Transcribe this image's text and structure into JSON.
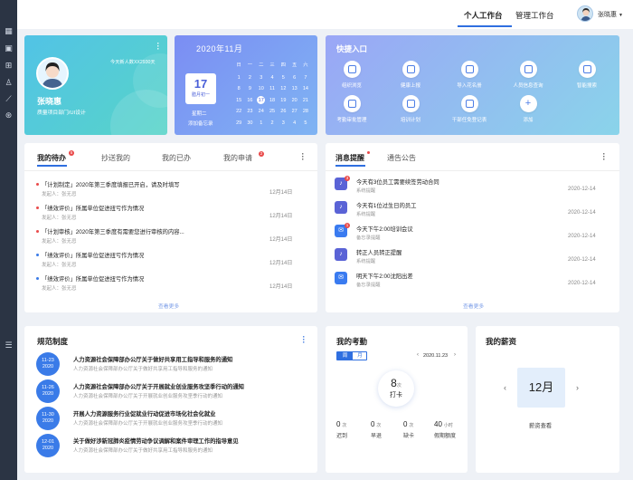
{
  "topbar": {
    "tabs": [
      {
        "label": "个人工作台"
      },
      {
        "label": "管理工作台"
      }
    ],
    "user_name": "张晓惠"
  },
  "profile": {
    "new_today": "今天新人数XX2930天",
    "name": "张晓惠",
    "dept": "质量项目部门/UI设计"
  },
  "calendar": {
    "month_title": "2020年11月",
    "day": "17",
    "lunar": "腊月初一",
    "weekday": "星期二",
    "add_memo": "添加备忘录",
    "week_head": [
      "日",
      "一",
      "二",
      "三",
      "四",
      "五",
      "六"
    ],
    "rows": [
      [
        "1",
        "2",
        "3",
        "4",
        "5",
        "6",
        "7"
      ],
      [
        "8",
        "9",
        "10",
        "11",
        "12",
        "13",
        "14"
      ],
      [
        "15",
        "16",
        "17",
        "18",
        "19",
        "20",
        "21"
      ],
      [
        "22",
        "23",
        "24",
        "25",
        "26",
        "27",
        "28"
      ],
      [
        "29",
        "30",
        "1",
        "2",
        "3",
        "4",
        "5"
      ]
    ],
    "today_index": "17"
  },
  "quick": {
    "title": "快捷入口",
    "items": [
      {
        "label": "组织浏览"
      },
      {
        "label": "健康上报"
      },
      {
        "label": "导入花名册"
      },
      {
        "label": "人员信息查询"
      },
      {
        "label": "智能搜索"
      },
      {
        "label": "考勤审批管理"
      },
      {
        "label": "培训计划"
      },
      {
        "label": "干部任免登记表"
      },
      {
        "label": "添加"
      }
    ]
  },
  "todo": {
    "tabs": [
      {
        "label": "我的待办",
        "badge": "5"
      },
      {
        "label": "抄送我的"
      },
      {
        "label": "我的已办"
      },
      {
        "label": "我的申请",
        "badge": "2"
      }
    ],
    "rows": [
      {
        "title": "「计划制定」2020年第三季度填报已开启，请及时填写",
        "sub": "发起人：张无忌",
        "date": "12月14日"
      },
      {
        "title": "「绩效评价」所属单位促进扭亏作为情况",
        "sub": "发起人：张无忌",
        "date": "12月14日"
      },
      {
        "title": "「计划审核」2020年第三季度有需要您进行审核的内容...",
        "sub": "发起人：张无忌",
        "date": "12月14日"
      },
      {
        "title": "「绩效评价」所属单位促进扭亏作为情况",
        "sub": "发起人：张无忌",
        "date": "12月14日"
      },
      {
        "title": "「绩效评价」所属单位促进扭亏作为情况",
        "sub": "发起人：张无忌",
        "date": "12月14日"
      }
    ],
    "more": "查看更多"
  },
  "notice": {
    "tabs": [
      {
        "label": "消息提醒"
      },
      {
        "label": "通告公告"
      }
    ],
    "rows": [
      {
        "title": "今天有3位员工需要续签劳动合同",
        "sub": "系统提醒",
        "date": "2020-12-14",
        "badge": "3"
      },
      {
        "title": "今天有1位过生日的员工",
        "sub": "系统提醒",
        "date": "2020-12-14"
      },
      {
        "title": "今天下午2:00培训会议",
        "sub": "备忘录提醒",
        "date": "2020-12-14",
        "badge": "1"
      },
      {
        "title": "转正人员转正提醒",
        "sub": "系统提醒",
        "date": "2020-12-14"
      },
      {
        "title": "明天下午2:00沈阳出差",
        "sub": "备忘录提醒",
        "date": "2020-12-14"
      }
    ],
    "more": "查看更多"
  },
  "rules": {
    "title": "规范制度",
    "rows": [
      {
        "date_mm": "11-23",
        "date_yy": "2020",
        "title": "人力资源社会保障部办公厅关于做好共享用工指导和服务的通知",
        "sub": "人力资源社会保障部办公厅关于做好共享用工指导和服务的通知"
      },
      {
        "date_mm": "11-26",
        "date_yy": "2020",
        "title": "人力资源社会保障部办公厅关于开展就业创业服务攻坚季行动的通知",
        "sub": "人力资源社会保障部办公厅关于开展就业创业服务攻坚季行动的通知"
      },
      {
        "date_mm": "11-30",
        "date_yy": "2020",
        "title": "开展人力资源服务行业促就业行动促进市场化社会化就业",
        "sub": "人力资源社会保障部办公厅关于开展就业创业服务攻坚季行动的通知"
      },
      {
        "date_mm": "12-01",
        "date_yy": "2020",
        "title": "关于做好涉新冠肺炎疫情劳动争议调解和案件审理工作的指导意见",
        "sub": "人力资源社会保障部办公厅关于做好共享用工指导和服务的通知"
      }
    ]
  },
  "attendance": {
    "title": "我的考勤",
    "toggle": [
      "周",
      "月"
    ],
    "date": "2020.11.23",
    "count": "8",
    "count_unit": "次",
    "punch": "打卡",
    "stats": [
      {
        "n": "0",
        "u": "次",
        "label": "迟到"
      },
      {
        "n": "0",
        "u": "次",
        "label": "早退"
      },
      {
        "n": "0",
        "u": "次",
        "label": "缺卡"
      },
      {
        "n": "40",
        "u": "小时",
        "label": "假期额度"
      }
    ]
  },
  "salary": {
    "title": "我的薪资",
    "month": "12月",
    "view": "薪资查看"
  },
  "colors": {
    "primary": "#2f6fe0",
    "badge_red": "#e94a4a",
    "sidebar": "#2b3444"
  }
}
